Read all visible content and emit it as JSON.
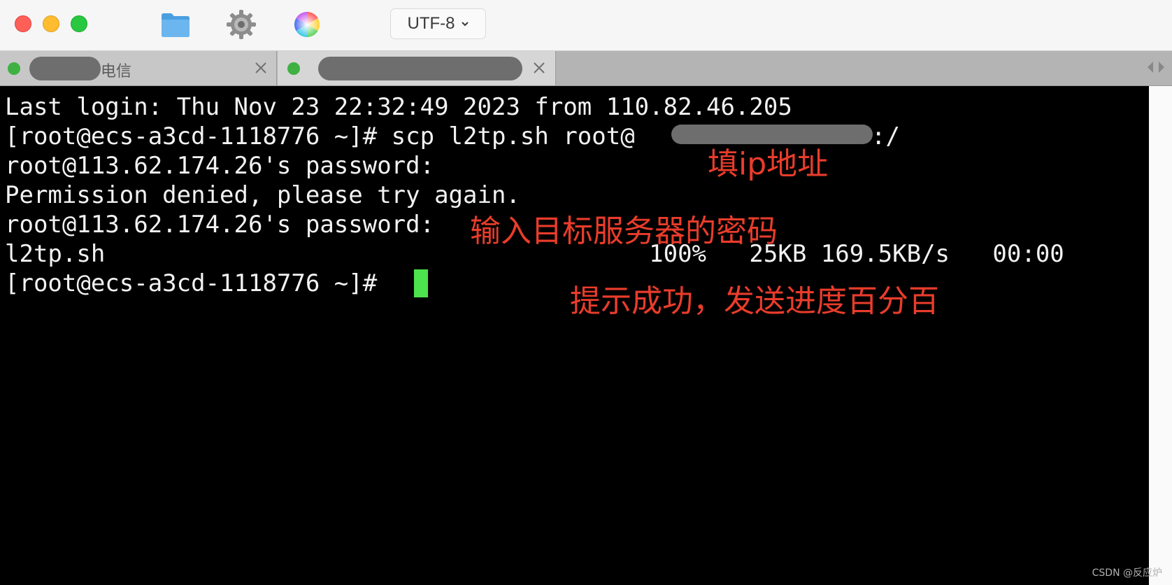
{
  "window": {
    "encoding": "UTF-8",
    "toolbar_icons": [
      "folder-icon",
      "gear-icon",
      "color-wheel-icon"
    ]
  },
  "tabs": [
    {
      "label": "电信",
      "status": "connected",
      "active": false
    },
    {
      "label": "",
      "status": "connected",
      "active": true
    }
  ],
  "terminal": {
    "lines": [
      "Last login: Thu Nov 23 22:32:49 2023 from 110.82.46.205",
      "[root@ecs-a3cd-1118776 ~]# scp l2tp.sh root@",
      "root@113.62.174.26's password:",
      "Permission denied, please try again.",
      "root@113.62.174.26's password:",
      "l2tp.sh                                      100%   25KB 169.5KB/s   00:00",
      "[root@ecs-a3cd-1118776 ~]# "
    ],
    "ip_suffix": ":/",
    "cursor_color": "#4ce34c"
  },
  "annotations": {
    "fill_ip": "填ip地址",
    "enter_password": "输入目标服务器的密码",
    "success": "提示成功，发送进度百分百",
    "color": "#e93c2b"
  },
  "watermark": "CSDN @反应炉"
}
